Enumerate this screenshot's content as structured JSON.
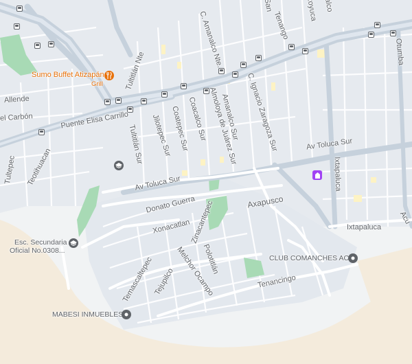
{
  "colors": {
    "land": "#f1f3f4",
    "block": "#dde3ea",
    "road": "#ffffff",
    "arterial": "#c6d1dc",
    "park": "#a8dab5",
    "sand": "#f4ebdc",
    "poi_gray": "#5f6368",
    "poi_orange": "#e8710a",
    "poi_purple": "#a142f4",
    "building_yellow": "#fdf3c4"
  },
  "streets": {
    "av_toluca_sur_west": "Av Toluca Sur",
    "av_toluca_sur_east": "Av Toluca Sur",
    "donato_guerra": "Donato Guerra",
    "xonacatlan": "Xonacatlan",
    "zinacantepec": "Zinacantepec",
    "axapusco": "Axapusco",
    "temascaltepec": "Temascaltepec",
    "tejupilco": "Tejupilco",
    "melchor_ocampo": "Melchor Ocampo",
    "polotitlan": "Polotitlán",
    "tenancingo": "Tenancingo",
    "ixtapaluca_h": "Ixtapaluca",
    "ixtapaluca_v": "Ixtapaluca",
    "puente_elisa_carrillo": "Puente Elisa Carrillo",
    "teotihuacan": "Teotihuacan",
    "tultepec": "Tultepec",
    "tultitlan_sur": "Tultitlán Sur",
    "tultitlan_nte": "Tultitlán Nte",
    "jilotepec_sur": "Jilotepec Sur",
    "coatepec_sur": "Coatepec Sur",
    "coacalco_sur": "Coacalco Sur",
    "almoloya_de_juarez_sur": "Almoloya de Juárez Sur",
    "amanalco_sur": "Amanalco Sur",
    "c_amanalco_nte": "C. Amanalco Nte.",
    "c_ignacio_zaragoza_sur": "C. Ignacio Zaragoza Sur",
    "tenango": "Tenango",
    "otumba": "Otumba",
    "acu": "Acu",
    "el_carbon": "el Carbón",
    "allende": "Allende",
    "zoyuca": "zoyuca",
    "san": "San",
    "alco": "alco"
  },
  "pois": {
    "sumo_buffet_name": "Sumo Buffet Atizapán",
    "sumo_buffet_sub": "Grill",
    "club_comanches": "CLUB COMANCHES AC",
    "esc_secundaria_line1": "Esc. Secundaria",
    "esc_secundaria_line2": "Oficial No.0308...",
    "mabesi": "MABESI INMUEBLES"
  },
  "icons": {
    "school": "school-icon",
    "restaurant": "restaurant-icon",
    "pin": "location-pin-icon",
    "worship": "place-of-worship-icon",
    "bus": "bus-stop-icon"
  }
}
